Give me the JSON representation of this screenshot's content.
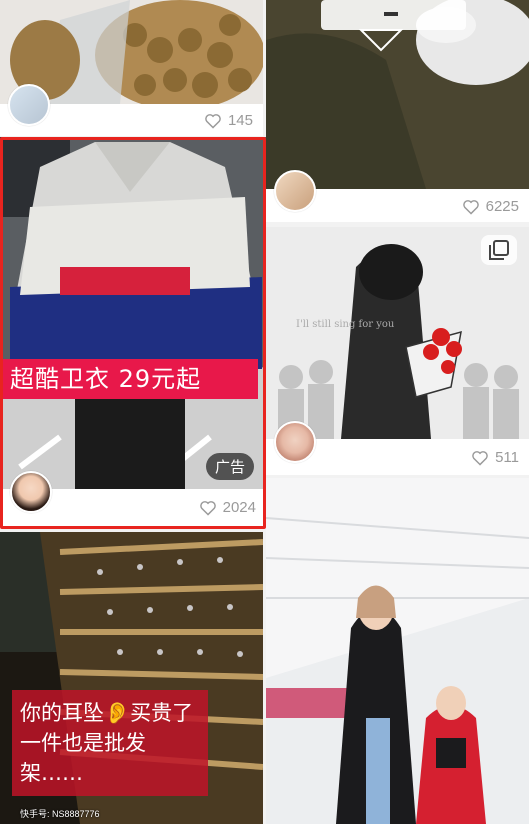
{
  "feed": {
    "cards": [
      {
        "id": "c1",
        "likes": "145"
      },
      {
        "id": "c2",
        "likes": "6225"
      },
      {
        "id": "c3",
        "likes": "2024",
        "ad_label": "广告",
        "promo_text": "超酷卫衣 29元起"
      },
      {
        "id": "c4",
        "likes": "511",
        "overlay_text": "I'll still sing for you"
      },
      {
        "id": "c5",
        "caption": "你的耳坠👂买贵了一件也是批发架……",
        "watermark": "快手号: NS8887776"
      },
      {
        "id": "c6"
      }
    ]
  },
  "icons": {
    "heart": "heart-icon",
    "multi_image": "multi-image-icon"
  },
  "colors": {
    "selected_border": "#e8241f",
    "promo_bg": "#e8184a",
    "like_text": "#9a9a9a"
  }
}
